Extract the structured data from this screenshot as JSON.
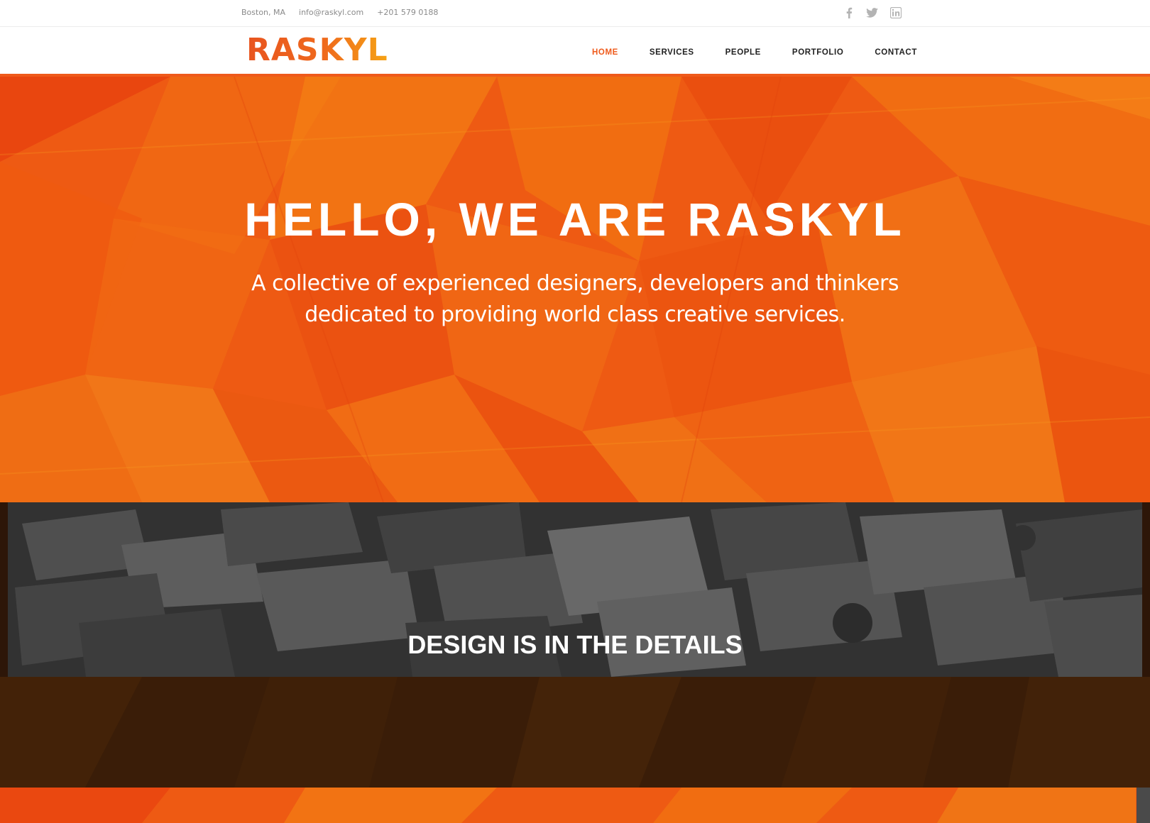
{
  "topbar": {
    "location": "Boston, MA",
    "email": "info@raskyl.com",
    "phone": "+201 579 0188",
    "social": [
      "facebook-icon",
      "twitter-icon",
      "linkedin-icon"
    ]
  },
  "header": {
    "logo": "RASKYL",
    "nav": [
      {
        "label": "HOME",
        "active": true
      },
      {
        "label": "SERVICES",
        "active": false
      },
      {
        "label": "PEOPLE",
        "active": false
      },
      {
        "label": "PORTFOLIO",
        "active": false
      },
      {
        "label": "CONTACT",
        "active": false
      }
    ]
  },
  "hero": {
    "title": "HELLO, WE ARE RASKYL",
    "subtitle_line1": "A collective of experienced designers, developers and thinkers",
    "subtitle_line2": "dedicated to providing world class creative services."
  },
  "section": {
    "title": "DESIGN IS IN THE DETAILS"
  },
  "colors": {
    "accent": "#ef5a1b",
    "hero_bg": "#ee5a13",
    "dark_band": "#3b3b3b",
    "brown_band": "#3a1d08"
  }
}
